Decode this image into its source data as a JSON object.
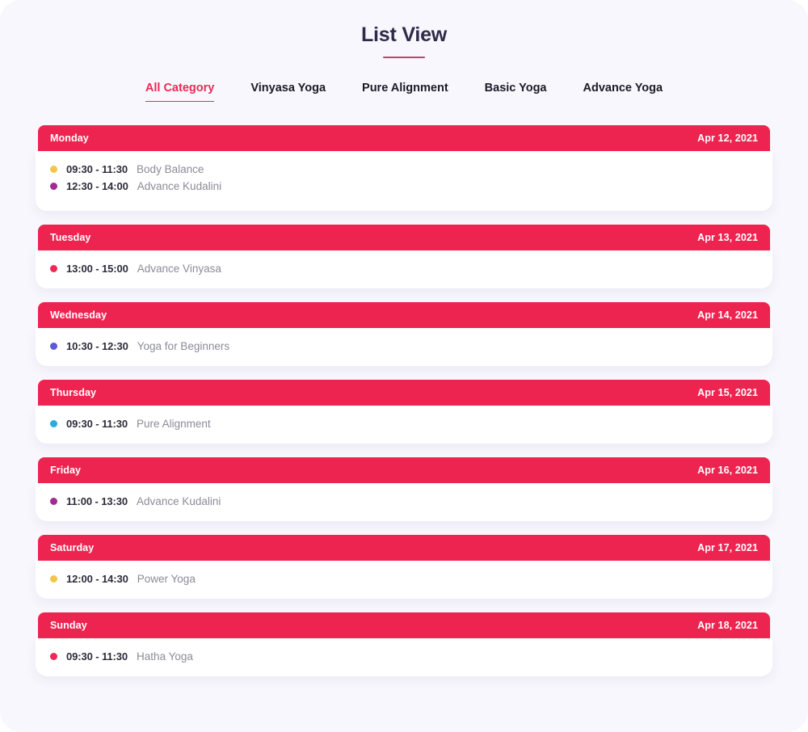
{
  "header": {
    "title": "List View"
  },
  "tabs": [
    {
      "label": "All Category",
      "active": true
    },
    {
      "label": "Vinyasa Yoga",
      "active": false
    },
    {
      "label": "Pure Alignment",
      "active": false
    },
    {
      "label": "Basic Yoga",
      "active": false
    },
    {
      "label": "Advance Yoga",
      "active": false
    }
  ],
  "colors": {
    "accent": "#ec2a54",
    "header_red": "#ee2450",
    "page_bg": "#f8f7fd",
    "title_color": "#2e2a49",
    "title_underline": "#c9416b",
    "time_text": "#2c2c3a",
    "event_text": "#8b8b99"
  },
  "days": [
    {
      "name": "Monday",
      "date": "Apr 12, 2021",
      "events": [
        {
          "time": "09:30 - 11:30",
          "title": "Body Balance",
          "dot_color": "#f3c54a"
        },
        {
          "time": "12:30 - 14:00",
          "title": "Advance Kudalini",
          "dot_color": "#a32a93"
        }
      ]
    },
    {
      "name": "Tuesday",
      "date": "Apr 13, 2021",
      "events": [
        {
          "time": "13:00 - 15:00",
          "title": "Advance Vinyasa",
          "dot_color": "#ec2a54"
        }
      ]
    },
    {
      "name": "Wednesday",
      "date": "Apr 14, 2021",
      "events": [
        {
          "time": "10:30 - 12:30",
          "title": "Yoga for Beginners",
          "dot_color": "#5b5bd6"
        }
      ]
    },
    {
      "name": "Thursday",
      "date": "Apr 15, 2021",
      "events": [
        {
          "time": "09:30 - 11:30",
          "title": "Pure Alignment",
          "dot_color": "#29abe2"
        }
      ]
    },
    {
      "name": "Friday",
      "date": "Apr 16, 2021",
      "events": [
        {
          "time": "11:00 - 13:30",
          "title": "Advance Kudalini",
          "dot_color": "#a32a93"
        }
      ]
    },
    {
      "name": "Saturday",
      "date": "Apr 17, 2021",
      "events": [
        {
          "time": "12:00 - 14:30",
          "title": "Power Yoga",
          "dot_color": "#f3c54a"
        }
      ]
    },
    {
      "name": "Sunday",
      "date": "Apr 18, 2021",
      "events": [
        {
          "time": "09:30 - 11:30",
          "title": "Hatha Yoga",
          "dot_color": "#ec2a54"
        }
      ]
    }
  ]
}
